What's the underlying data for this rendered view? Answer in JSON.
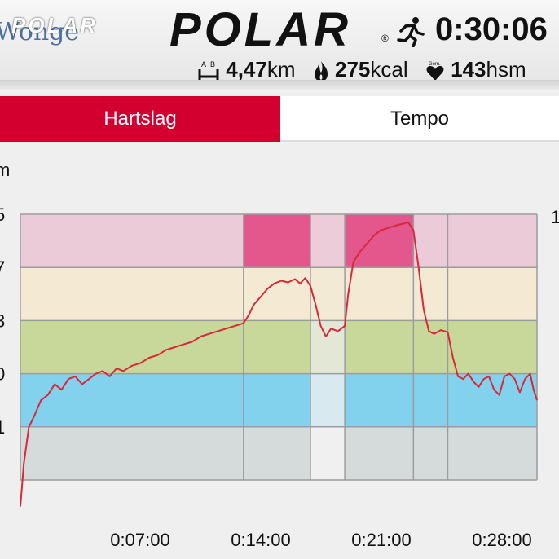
{
  "header": {
    "underlying_text": "Wonge",
    "small_logo": "POLAR",
    "big_logo": "POLAR",
    "registered_mark": "®",
    "sport_icon": "running-icon",
    "duration": "0:30:06",
    "distance_value": "4,47",
    "distance_unit": "km",
    "calories_value": "275",
    "calories_unit": "kcal",
    "avg_hr_value": "143",
    "avg_hr_unit": "hsm",
    "avg_hr_icon_label": "Gem."
  },
  "tabs": [
    {
      "label": "Hartslag",
      "active": true
    },
    {
      "label": "Tempo",
      "active": false
    }
  ],
  "chart": {
    "y_unit_label": "m",
    "y_ticks": [
      "5",
      "7",
      "3",
      "0",
      "1"
    ],
    "right_edge_label": "1",
    "x_ticks": [
      "0:07:00",
      "0:14:00",
      "0:21:00",
      "0:28:00"
    ],
    "zone_colors": [
      "#eccbd9",
      "#f4ead4",
      "#c7d89a",
      "#82d2ee",
      "#d5dadb"
    ],
    "zone_colors_active": [
      "#e3578c",
      "#f8d56c",
      "#a9cd7c",
      "#82d2ee",
      "#d5dadb"
    ],
    "zone_colors_muted": [
      "#ecccd8",
      "#f3ead6",
      "#e3e8d6",
      "#d9e9f0",
      "#f0f0f0"
    ],
    "line_color": "#d8283a"
  },
  "chart_data": {
    "type": "line",
    "x_unit": "minutes",
    "xlim": [
      0,
      30.1
    ],
    "zones": {
      "count": 5,
      "bottom_level": 0.0,
      "top_level": 5.0
    },
    "zone_segments": [
      {
        "start": 0.0,
        "end": 13.0,
        "zone": 2
      },
      {
        "start": 13.0,
        "end": 16.9,
        "zone": 5
      },
      {
        "start": 16.9,
        "end": 18.9,
        "zone": 1
      },
      {
        "start": 18.9,
        "end": 22.9,
        "zone": 5
      },
      {
        "start": 22.9,
        "end": 24.9,
        "zone": 2
      },
      {
        "start": 24.9,
        "end": 30.1,
        "zone": 2
      }
    ],
    "series": [
      {
        "values": [
          [
            0.0,
            -0.5
          ],
          [
            0.2,
            0.3
          ],
          [
            0.5,
            1.0
          ],
          [
            0.8,
            1.2
          ],
          [
            1.2,
            1.5
          ],
          [
            1.6,
            1.6
          ],
          [
            2.0,
            1.8
          ],
          [
            2.4,
            1.7
          ],
          [
            2.8,
            1.9
          ],
          [
            3.2,
            1.95
          ],
          [
            3.6,
            1.8
          ],
          [
            4.0,
            1.9
          ],
          [
            4.4,
            2.0
          ],
          [
            4.8,
            2.05
          ],
          [
            5.2,
            1.95
          ],
          [
            5.6,
            2.1
          ],
          [
            6.0,
            2.05
          ],
          [
            6.5,
            2.15
          ],
          [
            7.0,
            2.2
          ],
          [
            7.5,
            2.3
          ],
          [
            8.0,
            2.35
          ],
          [
            8.5,
            2.45
          ],
          [
            9.0,
            2.5
          ],
          [
            9.5,
            2.55
          ],
          [
            10.0,
            2.6
          ],
          [
            10.5,
            2.7
          ],
          [
            11.0,
            2.75
          ],
          [
            11.5,
            2.8
          ],
          [
            12.0,
            2.85
          ],
          [
            12.5,
            2.9
          ],
          [
            13.0,
            2.95
          ],
          [
            13.3,
            3.1
          ],
          [
            13.6,
            3.3
          ],
          [
            14.0,
            3.45
          ],
          [
            14.4,
            3.6
          ],
          [
            14.8,
            3.7
          ],
          [
            15.2,
            3.75
          ],
          [
            15.6,
            3.72
          ],
          [
            16.0,
            3.78
          ],
          [
            16.3,
            3.7
          ],
          [
            16.6,
            3.8
          ],
          [
            16.9,
            3.65
          ],
          [
            17.2,
            3.3
          ],
          [
            17.5,
            2.9
          ],
          [
            17.8,
            2.7
          ],
          [
            18.1,
            2.85
          ],
          [
            18.5,
            2.8
          ],
          [
            18.9,
            2.9
          ],
          [
            19.1,
            3.5
          ],
          [
            19.4,
            4.1
          ],
          [
            19.8,
            4.3
          ],
          [
            20.2,
            4.45
          ],
          [
            20.6,
            4.6
          ],
          [
            21.0,
            4.7
          ],
          [
            21.5,
            4.75
          ],
          [
            22.0,
            4.8
          ],
          [
            22.4,
            4.83
          ],
          [
            22.6,
            4.85
          ],
          [
            22.9,
            4.7
          ],
          [
            23.2,
            4.0
          ],
          [
            23.5,
            3.2
          ],
          [
            23.8,
            2.8
          ],
          [
            24.1,
            2.75
          ],
          [
            24.5,
            2.82
          ],
          [
            24.9,
            2.78
          ],
          [
            25.2,
            2.3
          ],
          [
            25.5,
            1.95
          ],
          [
            25.8,
            1.9
          ],
          [
            26.1,
            2.0
          ],
          [
            26.4,
            1.85
          ],
          [
            26.7,
            1.75
          ],
          [
            27.0,
            1.9
          ],
          [
            27.3,
            1.95
          ],
          [
            27.6,
            1.7
          ],
          [
            27.9,
            1.6
          ],
          [
            28.2,
            1.95
          ],
          [
            28.5,
            2.0
          ],
          [
            28.8,
            1.9
          ],
          [
            29.1,
            1.65
          ],
          [
            29.4,
            1.9
          ],
          [
            29.7,
            2.0
          ],
          [
            29.9,
            1.7
          ],
          [
            30.1,
            1.5
          ]
        ]
      }
    ]
  }
}
